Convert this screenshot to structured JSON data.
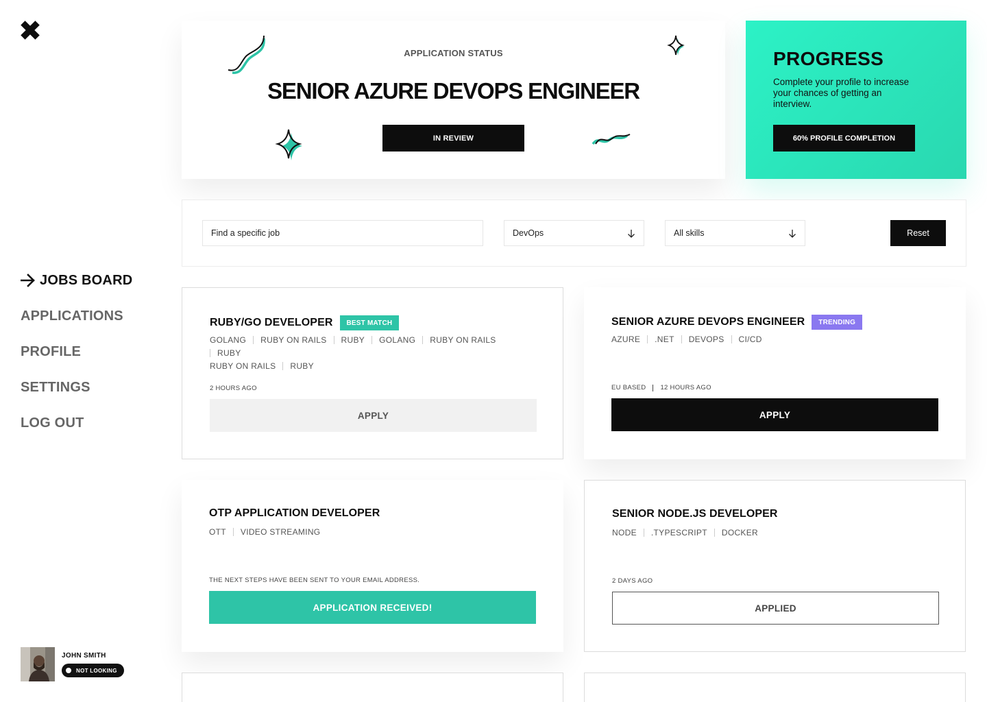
{
  "sidebar": {
    "nav": [
      {
        "label": "JOBS BOARD",
        "active": true
      },
      {
        "label": "APPLICATIONS"
      },
      {
        "label": "PROFILE"
      },
      {
        "label": "SETTINGS"
      },
      {
        "label": "LOG OUT"
      }
    ],
    "user": {
      "name": "JOHN SMITH",
      "status": "NOT LOOKING"
    }
  },
  "hero": {
    "eyebrow": "APPLICATION STATUS",
    "title": "SENIOR AZURE DEVOPS ENGINEER",
    "status_button": "IN REVIEW"
  },
  "progress": {
    "title": "PROGRESS",
    "text": "Complete your profile to increase your chances of getting an interview.",
    "button": "60% PROFILE COMPLETION",
    "completion_percent": 60
  },
  "filters": {
    "search_placeholder": "Find a specific job",
    "category": "DevOps",
    "skills": "All skills",
    "reset": "Reset"
  },
  "jobs": [
    {
      "title": "RUBY/GO DEVELOPER",
      "badge": "BEST MATCH",
      "tags_line1": [
        "GOLANG",
        "RUBY ON RAILS",
        "RUBY",
        "GOLANG",
        "RUBY ON RAILS",
        "RUBY"
      ],
      "tags_line2": [
        "RUBY ON RAILS",
        "RUBY"
      ],
      "meta": [
        "2 HOURS AGO"
      ],
      "button": "APPLY"
    },
    {
      "title": "SENIOR AZURE DEVOPS ENGINEER",
      "badge": "TRENDING",
      "tags_line1": [
        "AZURE",
        ".NET",
        "DEVOPS",
        "CI/CD"
      ],
      "meta": [
        "EU BASED",
        "12 HOURS AGO"
      ],
      "button": "APPLY"
    },
    {
      "title": "OTP APPLICATION DEVELOPER",
      "tags_line1": [
        "OTT",
        "VIDEO STREAMING"
      ],
      "meta": [
        "THE NEXT STEPS HAVE BEEN SENT TO YOUR EMAIL ADDRESS."
      ],
      "button": "APPLICATION RECEIVED!"
    },
    {
      "title": "SENIOR NODE.JS DEVELOPER",
      "tags_line1": [
        "NODE",
        ".TYPESCRIPT",
        "DOCKER"
      ],
      "meta": [
        "2 DAYS AGO"
      ],
      "button": "APPLIED"
    }
  ],
  "colors": {
    "accent_teal": "#2ec4a7",
    "progress_bg": "#2cf2c6",
    "trending_purple": "#8a78f0",
    "dark": "#0d0d0d"
  }
}
